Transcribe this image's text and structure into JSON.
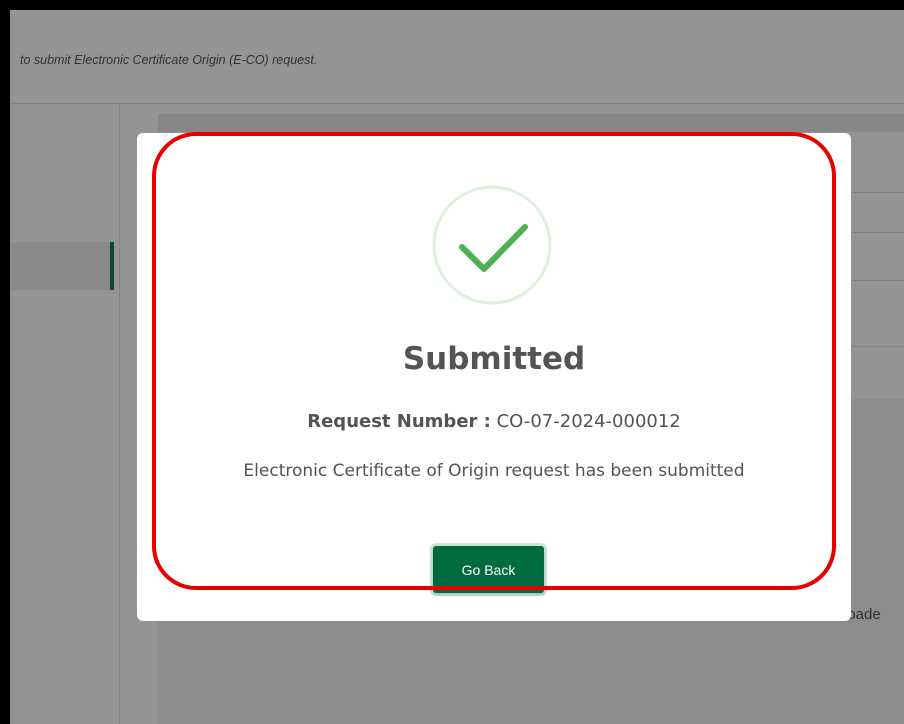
{
  "page": {
    "description": "to submit Electronic Certificate Origin (E-CO) request.",
    "background_fragment": "loade"
  },
  "modal": {
    "icon": "checkmark-circle-icon",
    "title": "Submitted",
    "request_label": "Request Number :",
    "request_number": "CO-07-2024-000012",
    "message": "Electronic Certificate of Origin request has been submitted",
    "button_label": "Go Back"
  },
  "colors": {
    "success_green": "#4caf50",
    "button_green": "#006b3f",
    "highlight_red": "#e60000"
  }
}
